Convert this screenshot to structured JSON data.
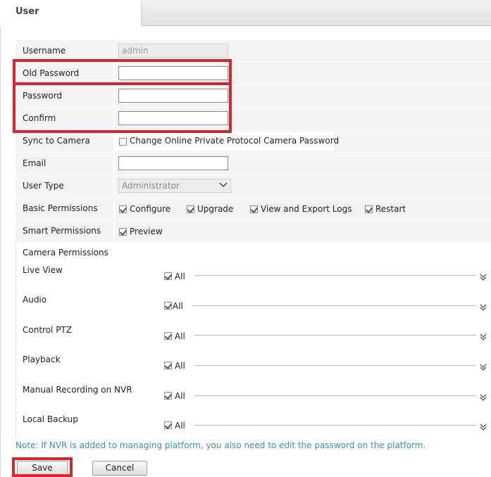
{
  "tab": {
    "title": "User"
  },
  "form": {
    "username_label": "Username",
    "username_value": "admin",
    "old_password_label": "Old Password",
    "password_label": "Password",
    "confirm_label": "Confirm",
    "sync_label": "Sync to Camera",
    "sync_option": "Change Online Private Protocol Camera Password",
    "email_label": "Email",
    "user_type_label": "User Type",
    "user_type_value": "Administrator",
    "basic_permissions_label": "Basic Permissions",
    "basic_permissions": [
      "Configure",
      "Upgrade",
      "View and Export Logs",
      "Restart"
    ],
    "smart_permissions_label": "Smart Permissions",
    "smart_permissions": [
      "Preview"
    ]
  },
  "camera_permissions": {
    "title": "Camera Permissions",
    "items": [
      {
        "label": "Live View",
        "all_label": "All"
      },
      {
        "label": "Audio",
        "all_label": "All"
      },
      {
        "label": "Control PTZ",
        "all_label": "All"
      },
      {
        "label": "Playback",
        "all_label": "All"
      },
      {
        "label": "Manual Recording on NVR",
        "all_label": "All"
      },
      {
        "label": "Local Backup",
        "all_label": "All"
      }
    ]
  },
  "note": "Note: If NVR is added to managing platform, you also need to edit the password on the platform.",
  "buttons": {
    "save": "Save",
    "cancel": "Cancel"
  },
  "icons": {
    "checkbox_checked": "checkmark-icon",
    "expand": "double-chevron-down-icon",
    "select": "chevron-down-icon"
  },
  "colors": {
    "highlight": "#d9232d",
    "note": "#3a8fb0",
    "row_bg": "#f3f3f3"
  }
}
